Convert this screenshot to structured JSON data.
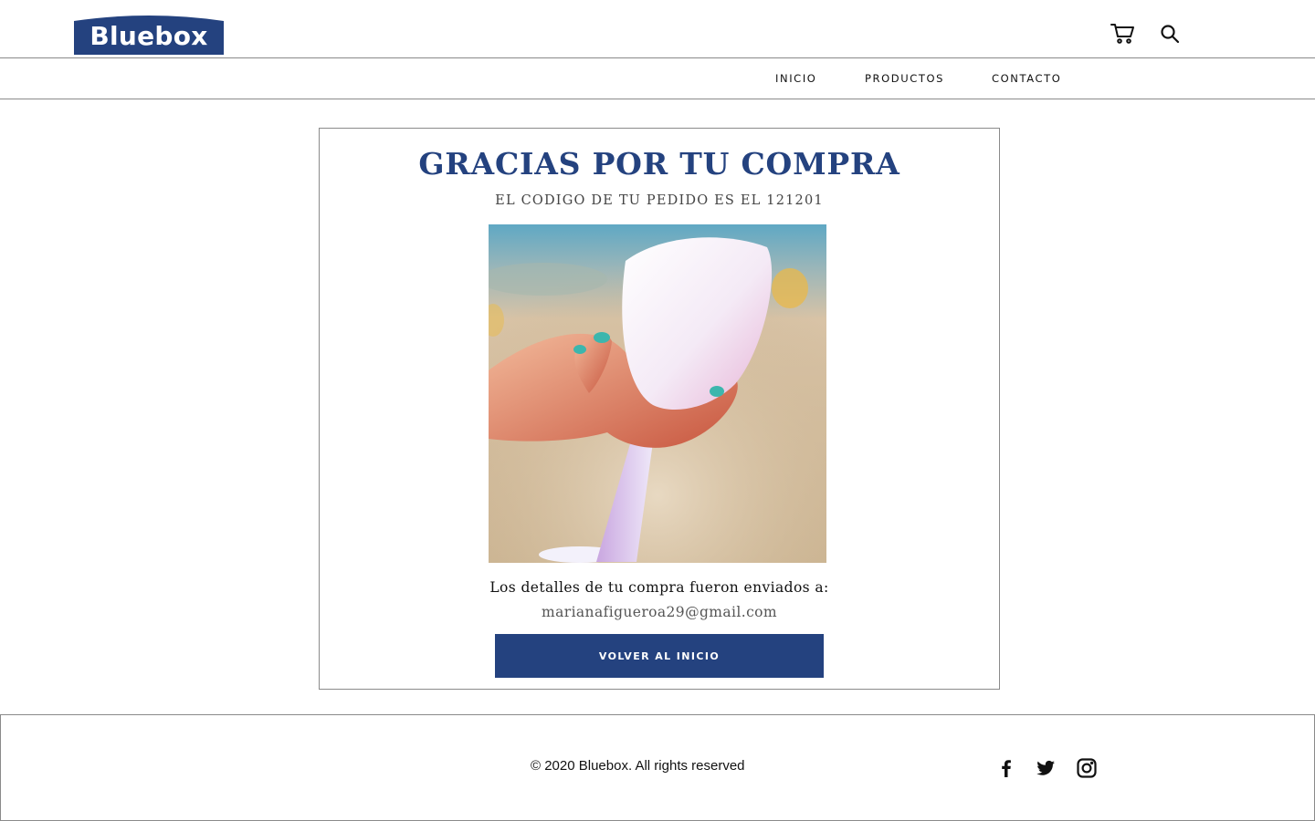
{
  "header": {
    "brand": "Bluebox",
    "brand_color": "#24427f",
    "icons": [
      "cart-icon",
      "search-icon"
    ]
  },
  "nav": {
    "items": [
      {
        "label": "INICIO"
      },
      {
        "label": "PRODUCTOS"
      },
      {
        "label": "CONTACTO"
      }
    ]
  },
  "confirmation": {
    "title": "GRACIAS POR TU COMPRA",
    "subtitle": "EL CODIGO DE TU PEDIDO ES EL 121201",
    "details_label": "Los detalles de tu compra fueron enviados a:",
    "email": "marianafigueroa29@gmail.com",
    "button_label": "VOLVER AL INICIO",
    "accent_color": "#24427f"
  },
  "footer": {
    "copyright": "© 2020 Bluebox. All rights reserved",
    "social_icons": [
      "facebook-icon",
      "twitter-icon",
      "instagram-icon"
    ]
  }
}
